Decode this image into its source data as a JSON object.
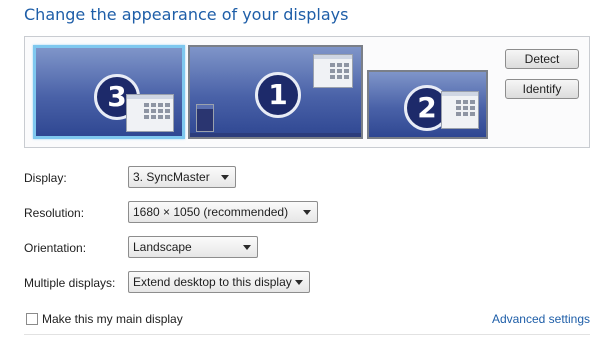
{
  "page": {
    "title": "Change the appearance of your displays"
  },
  "monitors": [
    {
      "number": "3",
      "selected": true
    },
    {
      "number": "1",
      "selected": false
    },
    {
      "number": "2",
      "selected": false
    }
  ],
  "buttons": {
    "detect": "Detect",
    "identify": "Identify"
  },
  "settings": {
    "display": {
      "label": "Display:",
      "value": "3. SyncMaster"
    },
    "resolution": {
      "label": "Resolution:",
      "value": "1680 × 1050 (recommended)"
    },
    "orientation": {
      "label": "Orientation:",
      "value": "Landscape"
    },
    "multiple": {
      "label": "Multiple displays:",
      "value": "Extend desktop to this display"
    }
  },
  "main_display": {
    "label": "Make this my main display",
    "checked": false
  },
  "advanced_link": "Advanced settings",
  "colors": {
    "accent": "#1e5ea8",
    "selected_border": "#7fc8ef",
    "monitor_fill": "#4a62a8"
  }
}
